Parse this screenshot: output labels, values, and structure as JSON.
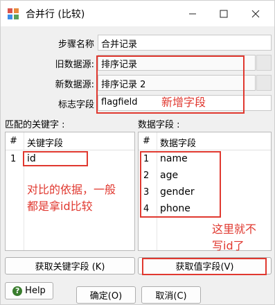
{
  "window": {
    "title": "合并行 (比较)"
  },
  "form": {
    "step_name_label": "步骤名称",
    "step_name_value": "合并记录",
    "old_source_label": "旧数据源:",
    "old_source_value": "排序记录",
    "new_source_label": "新数据源:",
    "new_source_value": "排序记录 2",
    "flag_label": "标志字段",
    "flag_value": "flagfield"
  },
  "key_panel": {
    "section_label": "匹配的关键字 :",
    "num_header": "#",
    "col_header": "关键字段",
    "rows": [
      {
        "num": "1",
        "value": "id"
      }
    ]
  },
  "value_panel": {
    "section_label": "数据字段 :",
    "num_header": "#",
    "col_header": "数据字段",
    "rows": [
      {
        "num": "1",
        "value": "name"
      },
      {
        "num": "2",
        "value": "age"
      },
      {
        "num": "3",
        "value": "gender"
      },
      {
        "num": "4",
        "value": "phone"
      }
    ]
  },
  "buttons": {
    "get_key_fields": "获取关键字段 (K)",
    "get_value_fields": "获取值字段(V)",
    "help": "Help",
    "ok": "确定(O)",
    "cancel": "取消(C)"
  },
  "annotations": {
    "new_field": "新增字段",
    "key_basis_line1": "对比的依据，一般",
    "key_basis_line2": "都是拿id比较",
    "no_id_line1": "这里就不",
    "no_id_line2": "写id了"
  },
  "colors": {
    "annotation_red": "#e0382f",
    "help_green": "#3a7d2e"
  }
}
